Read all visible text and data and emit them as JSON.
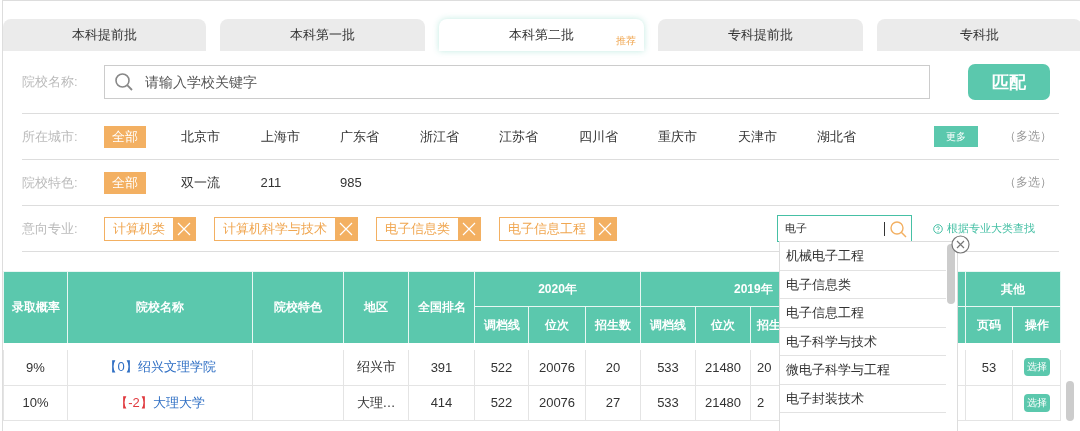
{
  "tabs": [
    {
      "label": "本科提前批",
      "selected": false
    },
    {
      "label": "本科第一批",
      "selected": false
    },
    {
      "label": "本科第二批",
      "selected": true,
      "badge": "推荐"
    },
    {
      "label": "专科提前批",
      "selected": false
    },
    {
      "label": "专科批",
      "selected": false
    }
  ],
  "search": {
    "label": "院校名称:",
    "placeholder": "请输入学校关键字",
    "button": "匹配"
  },
  "filters": [
    {
      "label": "所在城市:",
      "options": [
        {
          "label": "全部",
          "selected": true
        },
        {
          "label": "北京市",
          "selected": false
        },
        {
          "label": "上海市",
          "selected": false
        },
        {
          "label": "广东省",
          "selected": false
        },
        {
          "label": "浙江省",
          "selected": false
        },
        {
          "label": "江苏省",
          "selected": false
        },
        {
          "label": "四川省",
          "selected": false
        },
        {
          "label": "重庆市",
          "selected": false
        },
        {
          "label": "天津市",
          "selected": false
        },
        {
          "label": "湖北省",
          "selected": false
        }
      ],
      "more": "更多",
      "note": "（多选）"
    },
    {
      "label": "院校特色:",
      "options": [
        {
          "label": "全部",
          "selected": true
        },
        {
          "label": "双一流",
          "selected": false
        },
        {
          "label": "211",
          "selected": false
        },
        {
          "label": "985",
          "selected": false
        }
      ],
      "note": "（多选）"
    }
  ],
  "major": {
    "label": "意向专业:",
    "tags": [
      "计算机类",
      "计算机科学与技术",
      "电子信息类",
      "电子信息工程"
    ],
    "query": "电子",
    "link": "根据专业大类查找",
    "suggestions": [
      "机械电子工程",
      "电子信息类",
      "电子信息工程",
      "电子科学与技术",
      "微电子科学与工程",
      "电子封装技术"
    ]
  },
  "table": {
    "columns": [
      {
        "label": "录取概率"
      },
      {
        "label": "院校名称"
      },
      {
        "label": "院校特色"
      },
      {
        "label": "地区"
      },
      {
        "label": "全国排名"
      },
      {
        "label": "2020年",
        "colspan": 3
      },
      {
        "label": "2019年",
        "colspan": 3
      },
      {
        "label": "其他",
        "colspan": 2
      }
    ],
    "subcolumns": [
      "调档线",
      "位次",
      "招生数",
      "调档线",
      "位次",
      "招生",
      "页码",
      "操作"
    ],
    "rows": [
      {
        "cells": [
          "9%",
          {
            "change": "【0】",
            "color": "#2f6fc4",
            "name": "绍兴文理学院"
          },
          null,
          "绍兴市",
          "391",
          "522",
          "20076",
          "20",
          "533",
          "21480",
          "20",
          "53",
          {
            "action": "选择"
          }
        ]
      },
      {
        "cells": [
          "10%",
          {
            "change": "【-2】",
            "color": "#e0393e",
            "name": "大理大学"
          },
          null,
          "大理…",
          "414",
          "522",
          "20076",
          "27",
          "533",
          "21480",
          "2",
          null,
          {
            "action": "选择"
          }
        ]
      }
    ]
  }
}
